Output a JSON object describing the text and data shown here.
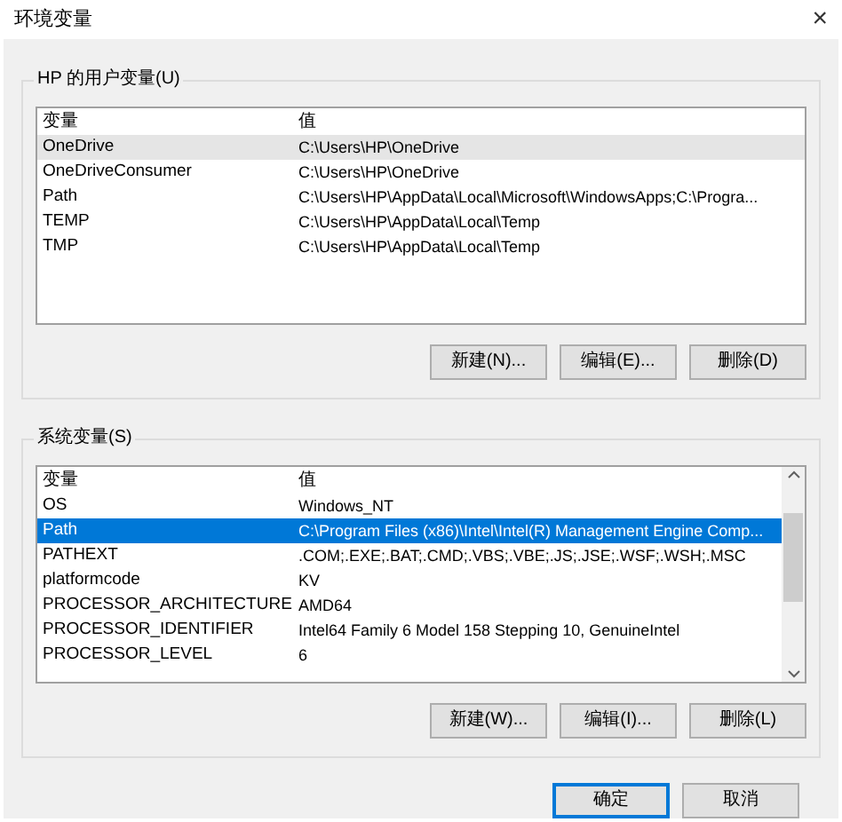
{
  "window": {
    "title": "环境变量",
    "close": "×"
  },
  "user_vars": {
    "label": "HP 的用户变量(U)",
    "focused": false,
    "columns": [
      "变量",
      "值"
    ],
    "rows": [
      {
        "name": "OneDrive",
        "value": "C:\\Users\\HP\\OneDrive",
        "selected": true
      },
      {
        "name": "OneDriveConsumer",
        "value": "C:\\Users\\HP\\OneDrive",
        "selected": false
      },
      {
        "name": "Path",
        "value": "C:\\Users\\HP\\AppData\\Local\\Microsoft\\WindowsApps;C:\\Progra...",
        "selected": false
      },
      {
        "name": "TEMP",
        "value": "C:\\Users\\HP\\AppData\\Local\\Temp",
        "selected": false
      },
      {
        "name": "TMP",
        "value": "C:\\Users\\HP\\AppData\\Local\\Temp",
        "selected": false
      }
    ],
    "buttons": [
      "新建(N)...",
      "编辑(E)...",
      "删除(D)"
    ]
  },
  "system_vars": {
    "label": "系统变量(S)",
    "focused": true,
    "columns": [
      "变量",
      "值"
    ],
    "rows": [
      {
        "name": "OS",
        "value": "Windows_NT",
        "selected": false
      },
      {
        "name": "Path",
        "value": "C:\\Program Files (x86)\\Intel\\Intel(R) Management Engine Comp...",
        "selected": true
      },
      {
        "name": "PATHEXT",
        "value": ".COM;.EXE;.BAT;.CMD;.VBS;.VBE;.JS;.JSE;.WSF;.WSH;.MSC",
        "selected": false
      },
      {
        "name": "platformcode",
        "value": "KV",
        "selected": false
      },
      {
        "name": "PROCESSOR_ARCHITECTURE",
        "value": "AMD64",
        "selected": false
      },
      {
        "name": "PROCESSOR_IDENTIFIER",
        "value": "Intel64 Family 6 Model 158 Stepping 10, GenuineIntel",
        "selected": false
      },
      {
        "name": "PROCESSOR_LEVEL",
        "value": "6",
        "selected": false
      }
    ],
    "buttons": [
      "新建(W)...",
      "编辑(I)...",
      "删除(L)"
    ]
  },
  "footer_buttons": [
    {
      "label": "确定",
      "default": true
    },
    {
      "label": "取消",
      "default": false
    }
  ]
}
